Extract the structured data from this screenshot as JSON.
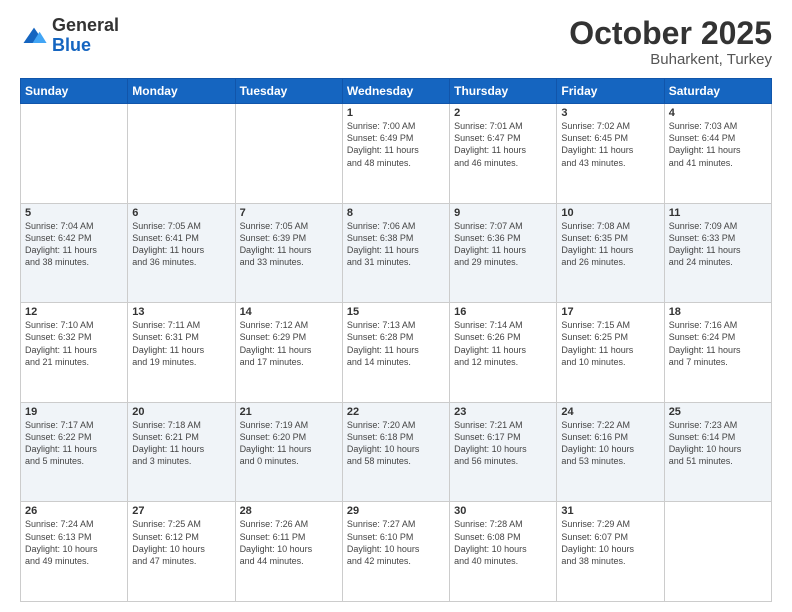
{
  "logo": {
    "general": "General",
    "blue": "Blue"
  },
  "header": {
    "month": "October 2025",
    "location": "Buharkent, Turkey"
  },
  "weekdays": [
    "Sunday",
    "Monday",
    "Tuesday",
    "Wednesday",
    "Thursday",
    "Friday",
    "Saturday"
  ],
  "weeks": [
    [
      {
        "day": "",
        "info": ""
      },
      {
        "day": "",
        "info": ""
      },
      {
        "day": "",
        "info": ""
      },
      {
        "day": "1",
        "info": "Sunrise: 7:00 AM\nSunset: 6:49 PM\nDaylight: 11 hours\nand 48 minutes."
      },
      {
        "day": "2",
        "info": "Sunrise: 7:01 AM\nSunset: 6:47 PM\nDaylight: 11 hours\nand 46 minutes."
      },
      {
        "day": "3",
        "info": "Sunrise: 7:02 AM\nSunset: 6:45 PM\nDaylight: 11 hours\nand 43 minutes."
      },
      {
        "day": "4",
        "info": "Sunrise: 7:03 AM\nSunset: 6:44 PM\nDaylight: 11 hours\nand 41 minutes."
      }
    ],
    [
      {
        "day": "5",
        "info": "Sunrise: 7:04 AM\nSunset: 6:42 PM\nDaylight: 11 hours\nand 38 minutes."
      },
      {
        "day": "6",
        "info": "Sunrise: 7:05 AM\nSunset: 6:41 PM\nDaylight: 11 hours\nand 36 minutes."
      },
      {
        "day": "7",
        "info": "Sunrise: 7:05 AM\nSunset: 6:39 PM\nDaylight: 11 hours\nand 33 minutes."
      },
      {
        "day": "8",
        "info": "Sunrise: 7:06 AM\nSunset: 6:38 PM\nDaylight: 11 hours\nand 31 minutes."
      },
      {
        "day": "9",
        "info": "Sunrise: 7:07 AM\nSunset: 6:36 PM\nDaylight: 11 hours\nand 29 minutes."
      },
      {
        "day": "10",
        "info": "Sunrise: 7:08 AM\nSunset: 6:35 PM\nDaylight: 11 hours\nand 26 minutes."
      },
      {
        "day": "11",
        "info": "Sunrise: 7:09 AM\nSunset: 6:33 PM\nDaylight: 11 hours\nand 24 minutes."
      }
    ],
    [
      {
        "day": "12",
        "info": "Sunrise: 7:10 AM\nSunset: 6:32 PM\nDaylight: 11 hours\nand 21 minutes."
      },
      {
        "day": "13",
        "info": "Sunrise: 7:11 AM\nSunset: 6:31 PM\nDaylight: 11 hours\nand 19 minutes."
      },
      {
        "day": "14",
        "info": "Sunrise: 7:12 AM\nSunset: 6:29 PM\nDaylight: 11 hours\nand 17 minutes."
      },
      {
        "day": "15",
        "info": "Sunrise: 7:13 AM\nSunset: 6:28 PM\nDaylight: 11 hours\nand 14 minutes."
      },
      {
        "day": "16",
        "info": "Sunrise: 7:14 AM\nSunset: 6:26 PM\nDaylight: 11 hours\nand 12 minutes."
      },
      {
        "day": "17",
        "info": "Sunrise: 7:15 AM\nSunset: 6:25 PM\nDaylight: 11 hours\nand 10 minutes."
      },
      {
        "day": "18",
        "info": "Sunrise: 7:16 AM\nSunset: 6:24 PM\nDaylight: 11 hours\nand 7 minutes."
      }
    ],
    [
      {
        "day": "19",
        "info": "Sunrise: 7:17 AM\nSunset: 6:22 PM\nDaylight: 11 hours\nand 5 minutes."
      },
      {
        "day": "20",
        "info": "Sunrise: 7:18 AM\nSunset: 6:21 PM\nDaylight: 11 hours\nand 3 minutes."
      },
      {
        "day": "21",
        "info": "Sunrise: 7:19 AM\nSunset: 6:20 PM\nDaylight: 11 hours\nand 0 minutes."
      },
      {
        "day": "22",
        "info": "Sunrise: 7:20 AM\nSunset: 6:18 PM\nDaylight: 10 hours\nand 58 minutes."
      },
      {
        "day": "23",
        "info": "Sunrise: 7:21 AM\nSunset: 6:17 PM\nDaylight: 10 hours\nand 56 minutes."
      },
      {
        "day": "24",
        "info": "Sunrise: 7:22 AM\nSunset: 6:16 PM\nDaylight: 10 hours\nand 53 minutes."
      },
      {
        "day": "25",
        "info": "Sunrise: 7:23 AM\nSunset: 6:14 PM\nDaylight: 10 hours\nand 51 minutes."
      }
    ],
    [
      {
        "day": "26",
        "info": "Sunrise: 7:24 AM\nSunset: 6:13 PM\nDaylight: 10 hours\nand 49 minutes."
      },
      {
        "day": "27",
        "info": "Sunrise: 7:25 AM\nSunset: 6:12 PM\nDaylight: 10 hours\nand 47 minutes."
      },
      {
        "day": "28",
        "info": "Sunrise: 7:26 AM\nSunset: 6:11 PM\nDaylight: 10 hours\nand 44 minutes."
      },
      {
        "day": "29",
        "info": "Sunrise: 7:27 AM\nSunset: 6:10 PM\nDaylight: 10 hours\nand 42 minutes."
      },
      {
        "day": "30",
        "info": "Sunrise: 7:28 AM\nSunset: 6:08 PM\nDaylight: 10 hours\nand 40 minutes."
      },
      {
        "day": "31",
        "info": "Sunrise: 7:29 AM\nSunset: 6:07 PM\nDaylight: 10 hours\nand 38 minutes."
      },
      {
        "day": "",
        "info": ""
      }
    ]
  ]
}
